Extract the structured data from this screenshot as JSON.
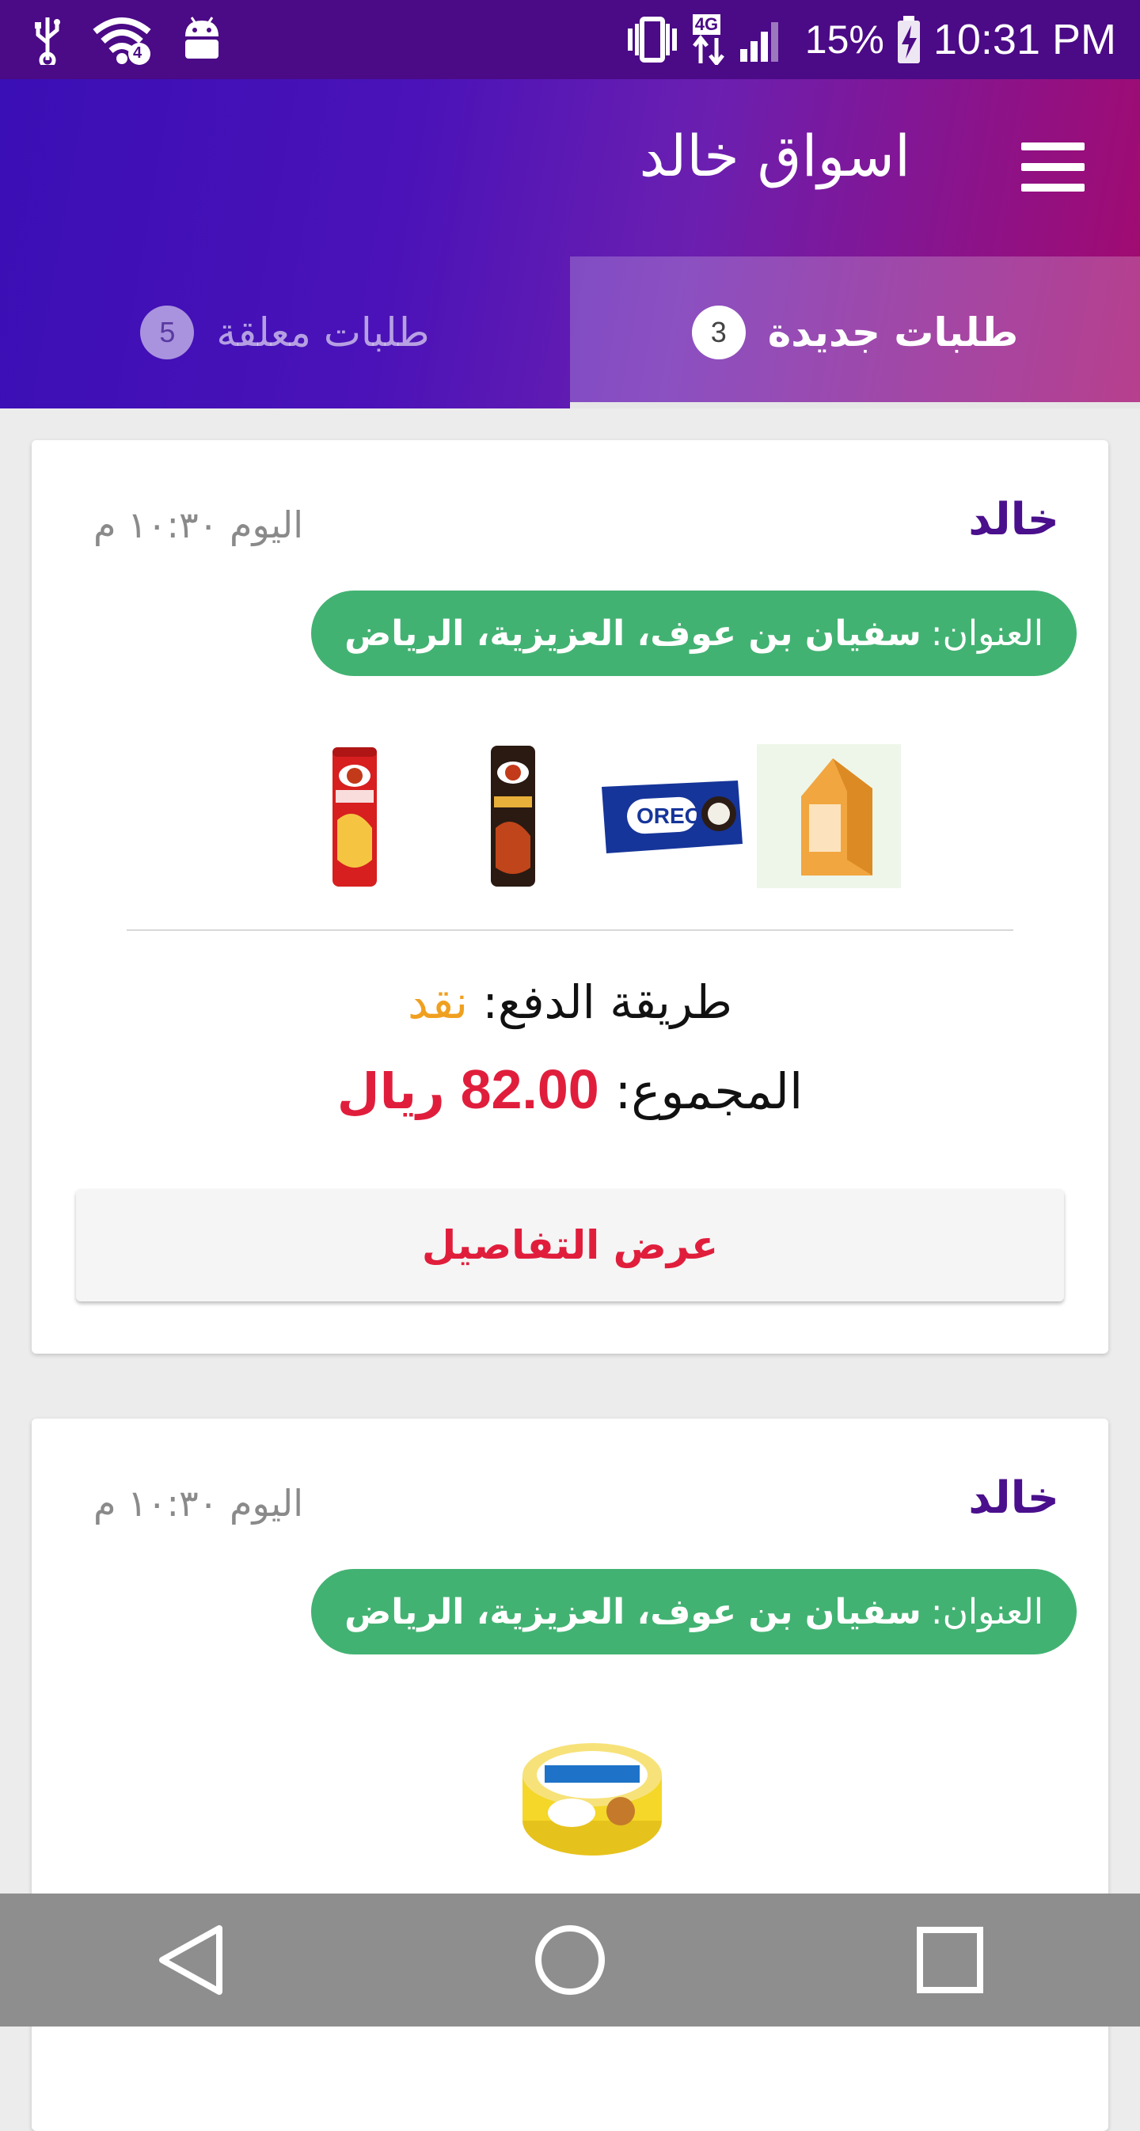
{
  "status_bar": {
    "time": "10:31 PM",
    "battery": "15%",
    "network": "4G",
    "wifi_badge": "4",
    "icons": [
      "usb-icon",
      "wifi-icon",
      "android-icon",
      "vibrate-icon",
      "data-4g-icon",
      "signal-icon",
      "battery-charging-icon"
    ]
  },
  "header": {
    "title": "اسواق خالد",
    "menu_icon": "hamburger-menu-icon",
    "gradient": [
      "#3a0fb5",
      "#a30a6e"
    ]
  },
  "tabs": [
    {
      "label": "طلبات جديدة",
      "count": "3",
      "active": true
    },
    {
      "label": "طلبات معلقة",
      "count": "5",
      "active": false
    }
  ],
  "orders": [
    {
      "customer": "خالد",
      "time": "اليوم ١٠:٣٠ م",
      "address_label": "العنوان:",
      "address": "سفيان بن عوف، العزيزية، الرياض",
      "products": [
        "pringles-red-can",
        "pringles-hot-can",
        "oreo-pack",
        "tea-box"
      ],
      "payment_label": "طريقة الدفع:",
      "payment_method": "نقد",
      "total_label": "المجموع:",
      "total_amount": "82.00",
      "currency": "ريال",
      "details_button": "عرض التفاصيل"
    },
    {
      "customer": "خالد",
      "time": "اليوم ١٠:٣٠ م",
      "address_label": "العنوان:",
      "address": "سفيان بن عوف، العزيزية، الرياض",
      "products": [
        "tuna-can"
      ]
    }
  ],
  "colors": {
    "accent_purple": "#4a0f8c",
    "address_green": "#42b272",
    "price_red": "#e01e3c",
    "cash_orange": "#f0a020"
  },
  "nav_bar": {
    "buttons": [
      "back-icon",
      "home-icon",
      "recents-icon"
    ]
  }
}
